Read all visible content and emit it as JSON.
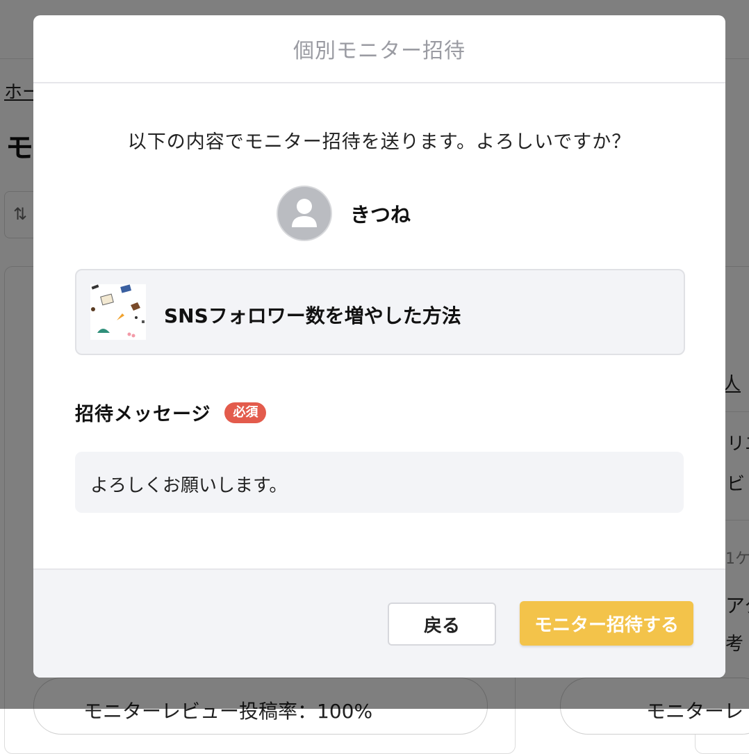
{
  "background": {
    "breadcrumb": "ホー",
    "page_title": "モ",
    "sort_icon": "⇅",
    "right_link": "人",
    "right_line1": "リエ",
    "right_line2": "ビ",
    "right_line3": "1ケ",
    "right_line4": "アク",
    "right_line5": "考",
    "bottom_left_text": "モニターレビュー投稿率：100%",
    "bottom_right_text": "モニターレ"
  },
  "modal": {
    "title": "個別モニター招待",
    "confirm_text": "以下の内容でモニター招待を送ります。よろしいですか？",
    "user": {
      "name": "きつね",
      "avatar_icon": "user-avatar-icon"
    },
    "post": {
      "title": "SNSフォロワー数を増やした方法"
    },
    "message": {
      "label": "招待メッセージ",
      "required_badge": "必須",
      "value": "よろしくお願いします。"
    },
    "footer": {
      "back_label": "戻る",
      "invite_label": "モニター招待する"
    }
  },
  "colors": {
    "accent": "#f3c34a",
    "required": "#e35b4c",
    "title_gray": "#9a9ba2"
  }
}
